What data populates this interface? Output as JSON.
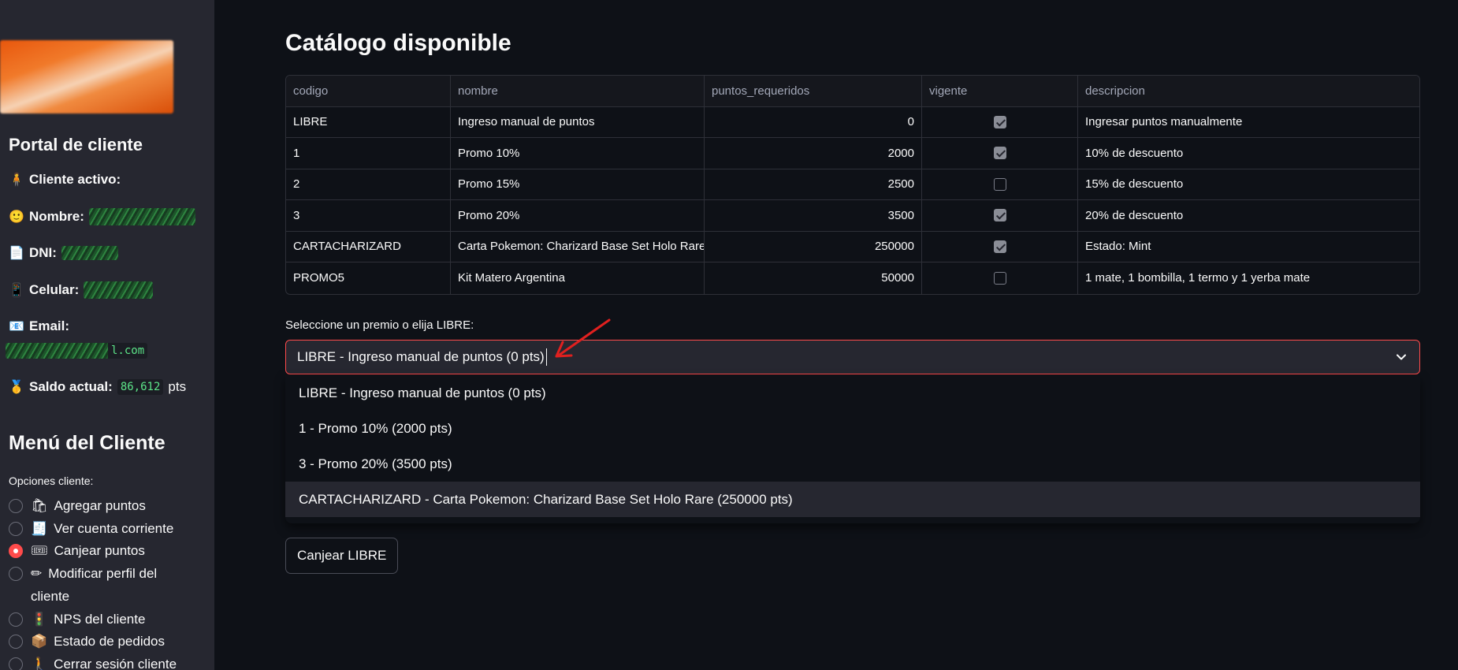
{
  "sidebar": {
    "portal_title": "Portal de cliente",
    "active_client_label": "Cliente activo:",
    "name_label": "Nombre:",
    "dni_label": "DNI:",
    "phone_label": "Celular:",
    "email_label": "Email:",
    "email_visible_suffix": "l.com",
    "balance_label": "Saldo actual:",
    "balance_value": "86,612",
    "balance_unit": "pts",
    "menu_title": "Menú del Cliente",
    "options_label": "Opciones cliente:",
    "options": [
      {
        "icon": "🛍",
        "label": "Agregar puntos",
        "selected": false
      },
      {
        "icon": "🧾",
        "label": "Ver cuenta corriente",
        "selected": false
      },
      {
        "icon": "🎟",
        "label": "Canjear puntos",
        "selected": true
      },
      {
        "icon": "✏",
        "label": "Modificar perfil del cliente",
        "selected": false
      },
      {
        "icon": "🚦",
        "label": "NPS del cliente",
        "selected": false
      },
      {
        "icon": "📦",
        "label": "Estado de pedidos",
        "selected": false
      },
      {
        "icon": "🚶",
        "label": "Cerrar sesión cliente",
        "selected": false
      }
    ]
  },
  "main": {
    "title": "Catálogo disponible",
    "table": {
      "columns": [
        "codigo",
        "nombre",
        "puntos_requeridos",
        "vigente",
        "descripcion"
      ],
      "rows": [
        {
          "codigo": "LIBRE",
          "nombre": "Ingreso manual de puntos",
          "puntos_requeridos": "0",
          "vigente": true,
          "descripcion": "Ingresar puntos manualmente"
        },
        {
          "codigo": "1",
          "nombre": "Promo 10%",
          "puntos_requeridos": "2000",
          "vigente": true,
          "descripcion": "10% de descuento"
        },
        {
          "codigo": "2",
          "nombre": "Promo 15%",
          "puntos_requeridos": "2500",
          "vigente": false,
          "descripcion": "15% de descuento"
        },
        {
          "codigo": "3",
          "nombre": "Promo 20%",
          "puntos_requeridos": "3500",
          "vigente": true,
          "descripcion": "20% de descuento"
        },
        {
          "codigo": "CARTACHARIZARD",
          "nombre": "Carta Pokemon: Charizard Base Set Holo Rare",
          "puntos_requeridos": "250000",
          "vigente": true,
          "descripcion": "Estado: Mint"
        },
        {
          "codigo": "PROMO5",
          "nombre": "Kit Matero Argentina",
          "puntos_requeridos": "50000",
          "vigente": false,
          "descripcion": "1 mate, 1 bombilla, 1 termo y 1 yerba mate"
        }
      ]
    },
    "select": {
      "label": "Seleccione un premio o elija LIBRE:",
      "value": "LIBRE - Ingreso manual de puntos (0 pts)",
      "options": [
        "LIBRE - Ingreso manual de puntos (0 pts)",
        "1 - Promo 10% (2000 pts)",
        "3 - Promo 20% (3500 pts)",
        "CARTACHARIZARD - Carta Pokemon: Charizard Base Set Holo Rare (250000 pts)"
      ]
    },
    "redeem_button": "Canjear LIBRE"
  },
  "colors": {
    "accent": "#ff4b4b",
    "sidebar_bg": "#262730",
    "main_bg": "#0e1117"
  }
}
